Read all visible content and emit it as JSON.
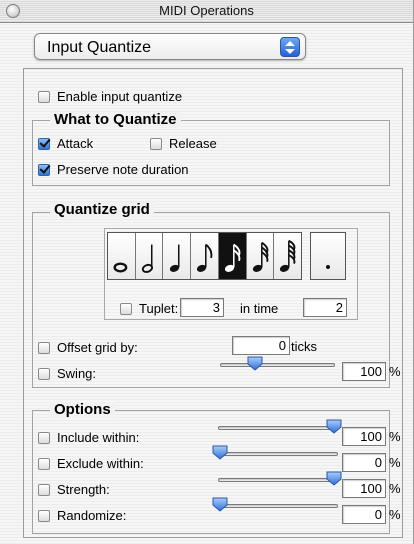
{
  "window": {
    "title": "MIDI Operations"
  },
  "popup": {
    "selected": "Input Quantize"
  },
  "enable": {
    "label": "Enable input quantize",
    "checked": false
  },
  "what": {
    "title": "What to Quantize",
    "attack": {
      "label": "Attack",
      "checked": true
    },
    "release": {
      "label": "Release",
      "checked": false
    },
    "preserve": {
      "label": "Preserve note duration",
      "checked": true
    }
  },
  "grid": {
    "title": "Quantize grid",
    "notes": [
      "whole-note-icon",
      "half-note-icon",
      "quarter-note-icon",
      "eighth-note-icon",
      "sixteenth-note-icon",
      "thirty-second-note-icon",
      "sixty-fourth-note-icon"
    ],
    "selected_index": 4,
    "tuplet": {
      "label": "Tuplet:",
      "value": "3",
      "in_time_label": "in time",
      "in_time_value": "2",
      "checked": false
    },
    "offset": {
      "label": "Offset grid by:",
      "value": "0",
      "unit": "ticks",
      "checked": false
    },
    "swing": {
      "label": "Swing:",
      "value": "100",
      "unit": "%",
      "level": 0.3,
      "checked": false
    }
  },
  "options": {
    "title": "Options",
    "include": {
      "label": "Include within:",
      "value": "100",
      "unit": "%",
      "level": 1.0,
      "checked": false
    },
    "exclude": {
      "label": "Exclude within:",
      "value": "0",
      "unit": "%",
      "level": 0.0,
      "checked": false
    },
    "strength": {
      "label": "Strength:",
      "value": "100",
      "unit": "%",
      "level": 1.0,
      "checked": false
    },
    "randomize": {
      "label": "Randomize:",
      "value": "0",
      "unit": "%",
      "level": 0.0,
      "checked": false
    }
  }
}
